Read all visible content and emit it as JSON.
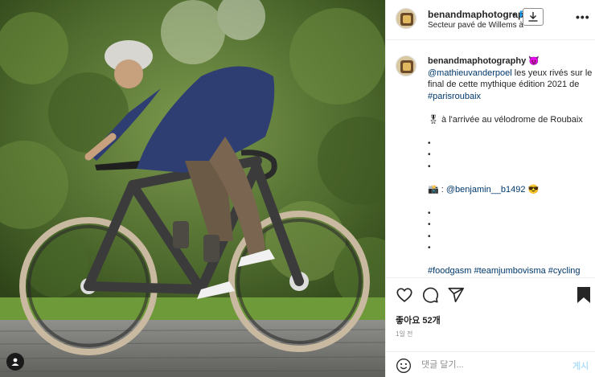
{
  "post": {
    "username": "benandmaphotography",
    "header_username": "benandmaphotograp",
    "dot": "•",
    "follow_label": "F",
    "location": "Secteur pavé de Willems à Hem",
    "more_label": "•••"
  },
  "caption": {
    "username": "benandmaphotography",
    "username_emoji": "😈",
    "mention": "@mathieuvanderpoel",
    "text_1": " les yeux rivés sur le",
    "text_2": "final de cette mythique édition 2021 de",
    "hashtag_1": "#parisroubaix",
    "line_arrival_emoji": "🎖",
    "line_arrival": "à l'arrivée au vélodrome de Roubaix 🏻",
    "credit_emoji": "📸",
    "credit_label": " : ",
    "credit_mention": "@benjamin__b1492",
    "credit_tail": " 😎",
    "hashtags_bottom": "#foodgasm #teamjumbovisma #cycling"
  },
  "actions": {
    "likes": "좋아요 52개",
    "time": "1일 전"
  },
  "comment": {
    "placeholder": "댓글 달기...",
    "post_label": "게시"
  },
  "colors": {
    "link": "#00376b",
    "follow": "#0095f6",
    "post_disabled": "#b2dffc",
    "border": "#efefef"
  },
  "icons": {
    "like": "heart-icon",
    "comment": "comment-bubble-icon",
    "share": "paper-plane-icon",
    "save": "bookmark-icon",
    "emoji": "smiley-icon",
    "download": "download-icon",
    "user_tag": "user-tag-icon"
  }
}
